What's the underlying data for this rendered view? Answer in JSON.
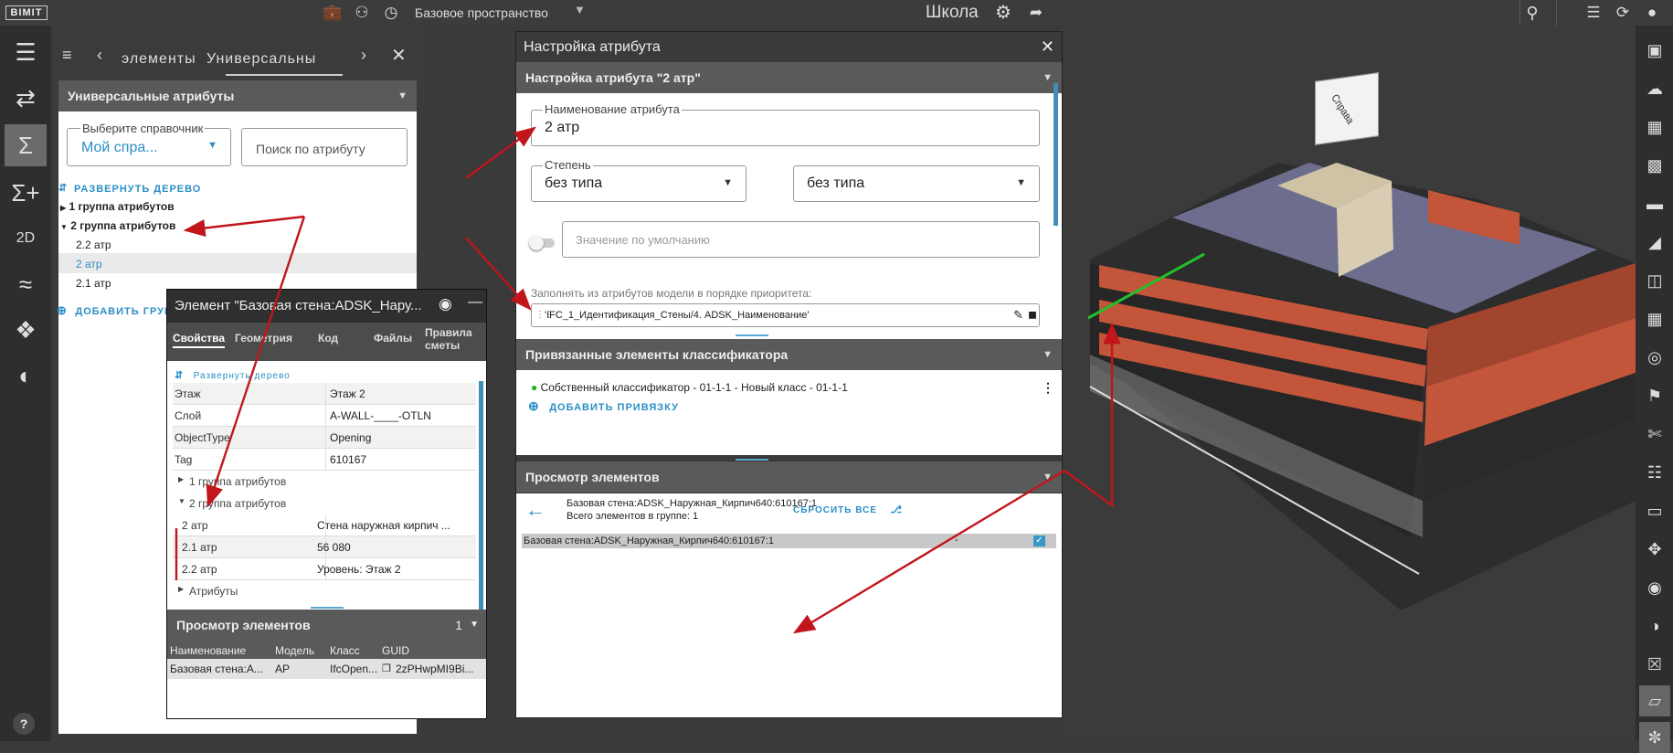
{
  "topbar": {
    "logo": "BIMIT",
    "workspace": "Базовое пространство",
    "project": "Школа"
  },
  "left_panel": {
    "tabs": [
      "элементы",
      "Универсальны"
    ],
    "header": "Универсальные атрибуты",
    "select_label": "Выберите справочник",
    "select_value": "Мой спра...",
    "search_placeholder": "Поиск по атрибуту",
    "expand_tree": "РАЗВЕРНУТЬ ДЕРЕВО",
    "groups": [
      {
        "label": "1 группа атрибутов"
      },
      {
        "label": "2 группа атрибутов"
      }
    ],
    "children": [
      "2.2 атр",
      "2 атр",
      "2.1 атр"
    ],
    "add_group": "ДОБАВИТЬ ГРУППУ"
  },
  "dialog": {
    "title": "Настройка атрибута",
    "section1": "Настройка атрибута \"2 атр\"",
    "name_label": "Наименование атрибута",
    "name_value": "2 атр",
    "degree_label": "Степень",
    "degree_value": "без типа",
    "type_value": "без типа",
    "default_placeholder": "Значение по умолчанию",
    "fill_label": "Заполнять из атрибутов модели в порядке приоритета:",
    "fill_item": "'IFC_1_Идентификация_Стены/4. ADSK_Наименование'",
    "section2": "Привязанные элементы классификатора",
    "classifier_item": "Собственный классификатор - 01-1-1 - Новый класс - 01-1-1",
    "add_binding": "ДОБАВИТЬ ПРИВЯЗКУ",
    "section3": "Просмотр элементов",
    "view_element": "Базовая стена:ADSK_Наружная_Кирпич640:610167:1",
    "reset_all": "СБРОСИТЬ ВСЕ",
    "group_count": "Всего элементов в группе: 1",
    "row_name": "Базовая стена:ADSK_Наружная_Кирпич640:610167:1",
    "row_dash": "-"
  },
  "element_panel": {
    "title": "Элемент \"Базовая стена:ADSK_Нару...",
    "tabs": [
      "Свойства",
      "Геометрия",
      "Код",
      "Файлы",
      "Правила сметы"
    ],
    "expand_tree": "Развернуть дерево",
    "props": [
      {
        "k": "Этаж",
        "v": "Этаж 2"
      },
      {
        "k": "Слой",
        "v": "A-WALL-____-OTLN"
      },
      {
        "k": "ObjectType",
        "v": "Opening"
      },
      {
        "k": "Tag",
        "v": "610167"
      }
    ],
    "group1": "1 группа атрибутов",
    "group2": "2 группа атрибутов",
    "attrs": [
      {
        "k": "2 атр",
        "v": "Стена наружная кирпич ..."
      },
      {
        "k": "2.1 атр",
        "v": "56 080"
      },
      {
        "k": "2.2 атр",
        "v": "Уровень: Этаж 2"
      }
    ],
    "attributes": "Атрибуты",
    "view_header": "Просмотр элементов",
    "view_count": "1",
    "cols": [
      "Наименование",
      "Модель",
      "Класс",
      "GUID"
    ],
    "row": [
      "Базовая стена:А...",
      "АР",
      "IfcOpen...",
      "2zPHwpMI9Bi..."
    ]
  },
  "viewcube": {
    "face": "Справа"
  },
  "colors": {
    "accent": "#2a8ec6",
    "arrow": "#c0161c",
    "header": "#5a5a5a"
  }
}
